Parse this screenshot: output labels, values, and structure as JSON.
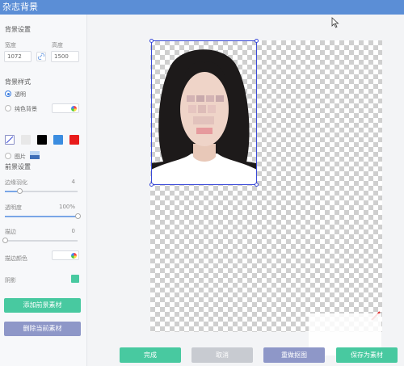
{
  "app": {
    "title": "杂志背景"
  },
  "bg_settings": {
    "section_title": "背景设置",
    "width_label": "宽度",
    "height_label": "高度",
    "width_value": "1072",
    "height_value": "1500"
  },
  "bg_style": {
    "section_title": "背景样式",
    "transparent_label": "透明",
    "solid_label": "纯色背景",
    "image_label": "图片",
    "swatches": [
      "#e8e8e8",
      "#000000",
      "#3b8de0",
      "#e81b1b"
    ],
    "selected": "transparent"
  },
  "fg_settings": {
    "section_title": "前景设置",
    "feather_label": "边缘羽化",
    "feather_value": "4",
    "feather_fraction": 0.2,
    "opacity_label": "透明度",
    "opacity_value": "100%",
    "opacity_fraction": 1.0,
    "stroke_label": "描边",
    "stroke_value": "0",
    "stroke_fraction": 0.0,
    "stroke_color_label": "描边颜色",
    "shadow_label": "阴影",
    "shadow_color": "#48c9a0"
  },
  "actions": {
    "add_fg_label": "添加前景素材",
    "delete_fg_label": "删除当前素材"
  },
  "bottom": {
    "done_label": "完成",
    "cancel_label": "取消",
    "redo_label": "重做抠图",
    "save_label": "保存为素材"
  },
  "colors": {
    "accent": "#5b8ed6",
    "green": "#48c9a0",
    "gray_button": "#c8cbd1",
    "purple_button": "#8e97c8",
    "selection": "#3a4ad8"
  }
}
